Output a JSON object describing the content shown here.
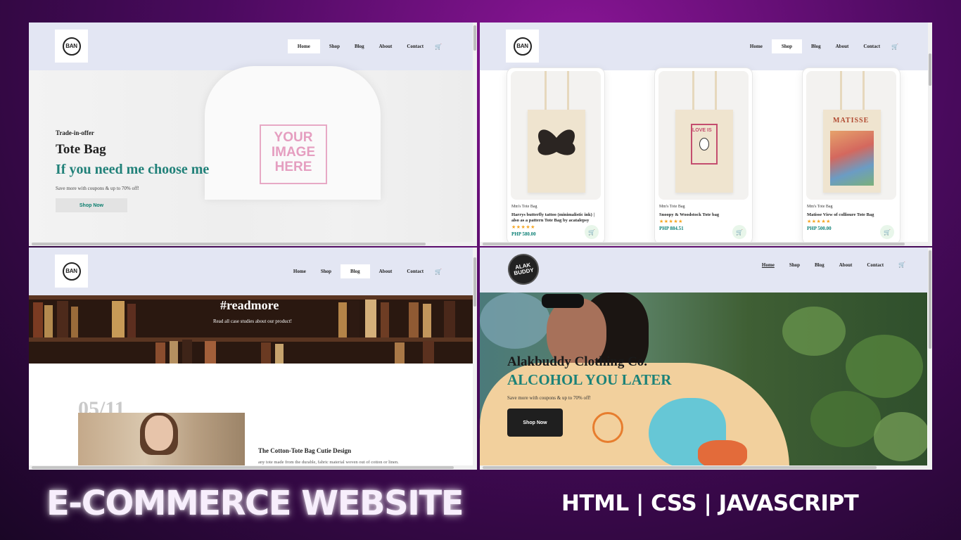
{
  "panel1": {
    "logo_text": "BAN",
    "nav": [
      "Home",
      "Shop",
      "Blog",
      "About",
      "Contact"
    ],
    "shirt_print": "YOUR IMAGE HERE",
    "hero_small": "Trade-in-offer",
    "hero_title": "Tote Bag",
    "hero_subtitle": "If you need me choose me",
    "hero_note": "Save more with coupons & up to 70% off!",
    "shop_button": "Shop Now"
  },
  "panel2": {
    "logo_text": "BAN",
    "nav": [
      "Home",
      "Shop",
      "Blog",
      "About",
      "Contact"
    ],
    "products": [
      {
        "brand": "Mm's Tote Bag",
        "name": "Harrys butterfly tattoo (minimalistic ink) | also as a pattern Tote Bag by acatalepsy",
        "stars": "★★★★★",
        "price": "PHP 580.00",
        "print": "butterfly"
      },
      {
        "brand": "Mm's Tote Bag",
        "name": "Snoopy & Woodstock Tote bag",
        "stars": "★★★★★",
        "price": "PHP 884.51",
        "print": "LOVE IS"
      },
      {
        "brand": "Mm's Tote Bag",
        "name": "Matisse View of collioure Tote Bag",
        "stars": "★★★★★",
        "price": "PHP 500.00",
        "print": "MATISSE"
      }
    ],
    "cart_icon": "🛒"
  },
  "panel3": {
    "logo_text": "BAN",
    "nav": [
      "Home",
      "Shop",
      "Blog",
      "About",
      "Contact"
    ],
    "banner_title": "#readmore",
    "banner_sub": "Read all case studies about our product!",
    "date": "05/11",
    "post_title": "The Cotton-Tote Bag Cutie Design",
    "post_text": "any tote made from the durable, fabric material woven out of cotton or linen."
  },
  "panel4": {
    "logo_text": "ALAK BUDDY",
    "nav": [
      "Home",
      "Shop",
      "Blog",
      "About",
      "Contact"
    ],
    "hero_title": "Alakbuddy Clothing Co.",
    "hero_subtitle": "ALCOHOL YOU LATER",
    "hero_note": "Save more with coupons & up to 70% off!",
    "shop_button": "Shop Now"
  },
  "footer": {
    "title": "E-COMMERCE WEBSITE",
    "tech": "HTML | CSS | JAVASCRIPT"
  },
  "colors": {
    "accent_teal": "#218179",
    "nav_bg": "#e3e6f3",
    "background_purple": "#8a1596"
  }
}
